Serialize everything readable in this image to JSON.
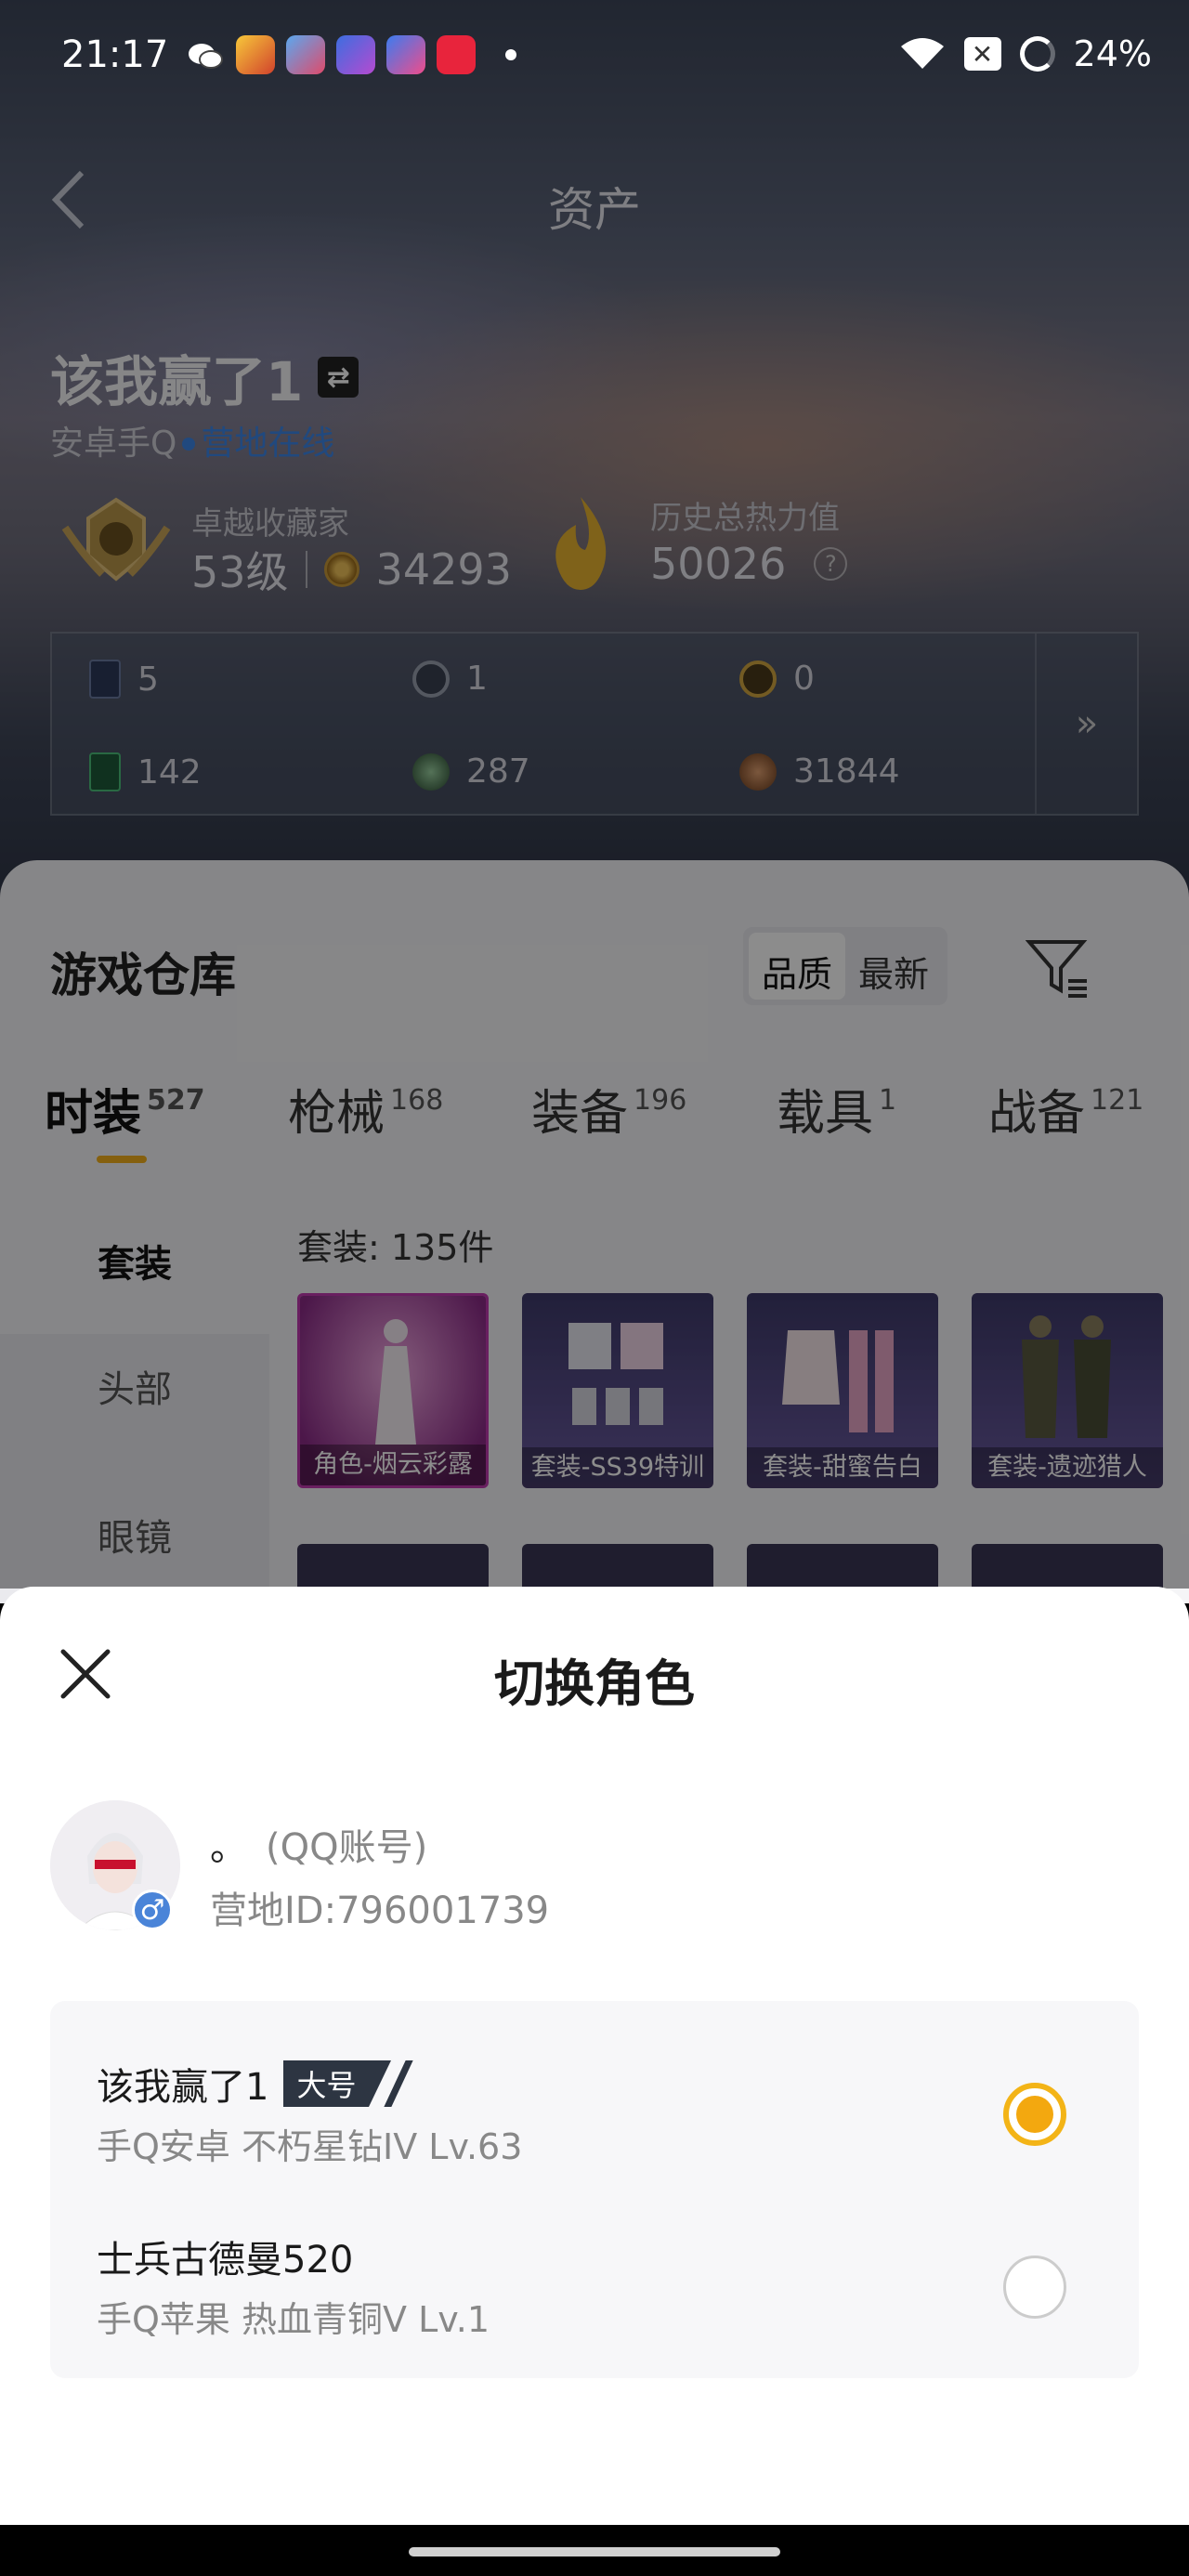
{
  "status_bar": {
    "time": "21:17",
    "battery": "24%",
    "box_label": "✕"
  },
  "header": {
    "title": "资产"
  },
  "player": {
    "name": "该我赢了1",
    "platform": "安卓手Q",
    "online_status": "营地在线",
    "rank_title": "卓越收藏家",
    "rank_level": "53级",
    "coins": "34293",
    "heat_title": "历史总热力值",
    "heat_value": "50026",
    "help": "?"
  },
  "currencies": {
    "c1": "5",
    "c2": "1",
    "c3": "0",
    "c4": "142",
    "c5": "287",
    "c6": "31844",
    "more": "»"
  },
  "warehouse": {
    "title": "游戏仓库",
    "sort_quality": "品质",
    "sort_newest": "最新",
    "tabs": [
      {
        "label": "时装",
        "count": "527"
      },
      {
        "label": "枪械",
        "count": "168"
      },
      {
        "label": "装备",
        "count": "196"
      },
      {
        "label": "载具",
        "count": "1"
      },
      {
        "label": "战备",
        "count": "121"
      }
    ],
    "side_nav": [
      "套装",
      "头部",
      "眼镜"
    ],
    "suit_count": "套装: 135件",
    "items": [
      {
        "label": "角色-烟云彩露"
      },
      {
        "label": "套装-SS39特训"
      },
      {
        "label": "套装-甜蜜告白"
      },
      {
        "label": "套装-遗迹猎人"
      }
    ]
  },
  "switch_role": {
    "title": "切换角色",
    "account_name": "。",
    "account_type": "(QQ账号)",
    "account_id": "营地ID:796001739",
    "gender": "♂",
    "roles": [
      {
        "name": "该我赢了1",
        "tag": "大号",
        "info": "手Q安卓  不朽星钻IV  Lv.63",
        "selected": true
      },
      {
        "name": "士兵古德曼520",
        "tag": "",
        "info": "手Q苹果  热血青铜V  Lv.1",
        "selected": false
      }
    ]
  },
  "colors": {
    "accent": "#f3a80f",
    "online": "#3c86e6",
    "tag_bg": "#2d3542"
  }
}
